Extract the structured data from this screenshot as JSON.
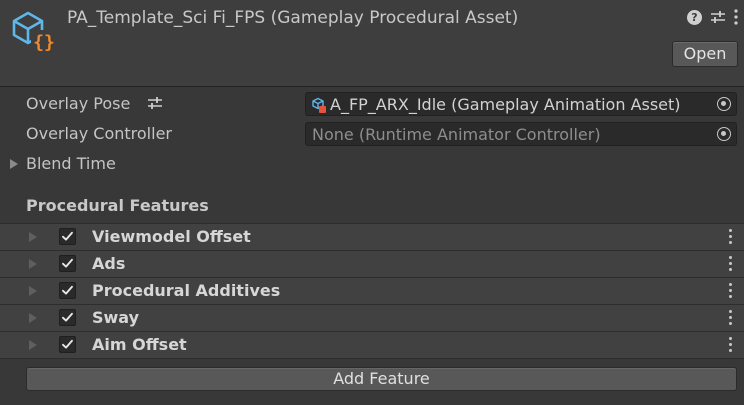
{
  "header": {
    "title": "PA_Template_Sci Fi_FPS (Gameplay Procedural Asset)",
    "asset_icon": "cube-braces-icon",
    "open_label": "Open",
    "icons": [
      "help-icon",
      "sliders-icon",
      "more-vertical-icon"
    ]
  },
  "properties": {
    "overlay_pose": {
      "label": "Overlay Pose",
      "value": "A_FP_ARX_Idle (Gameplay Animation Asset)"
    },
    "overlay_controller": {
      "label": "Overlay Controller",
      "value": "None (Runtime Animator Controller)"
    },
    "blend_time": {
      "label": "Blend Time"
    }
  },
  "procedural_features": {
    "title": "Procedural Features",
    "items": [
      {
        "label": "Viewmodel Offset",
        "checked": true
      },
      {
        "label": "Ads",
        "checked": true
      },
      {
        "label": "Procedural Additives",
        "checked": true
      },
      {
        "label": "Sway",
        "checked": true
      },
      {
        "label": "Aim Offset",
        "checked": true
      }
    ],
    "add_label": "Add Feature"
  },
  "colors": {
    "background": "#383838",
    "header": "#3e3e3e",
    "icon_blue": "#5fb6e8",
    "icon_orange": "#f08a2c"
  }
}
